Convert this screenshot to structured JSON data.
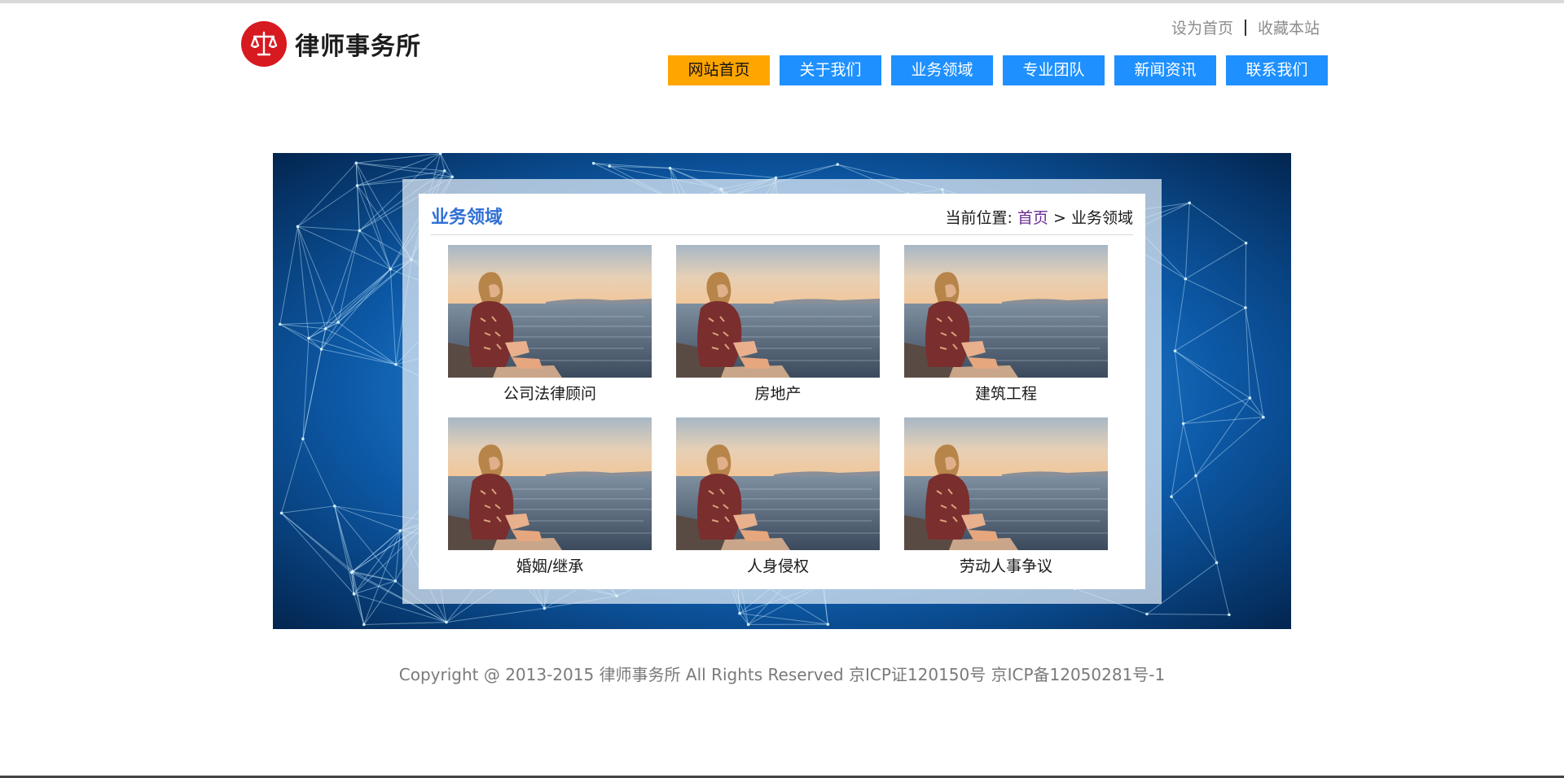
{
  "brand": {
    "name": "律师事务所",
    "color": "#d71920"
  },
  "quick_links": {
    "set_home": "设为首页",
    "bookmark": "收藏本站"
  },
  "nav": {
    "items": [
      {
        "label": "网站首页",
        "active": true
      },
      {
        "label": "关于我们",
        "active": false
      },
      {
        "label": "业务领域",
        "active": false
      },
      {
        "label": "专业团队",
        "active": false
      },
      {
        "label": "新闻资讯",
        "active": false
      },
      {
        "label": "联系我们",
        "active": false
      }
    ],
    "active_color": "#ffa500",
    "color": "#1e90ff"
  },
  "section": {
    "title": "业务领域",
    "breadcrumb": {
      "prefix": "当前位置:",
      "home": "首页",
      "separator": ">",
      "current": "业务领域"
    }
  },
  "practice_areas": [
    {
      "label": "公司法律顾问"
    },
    {
      "label": "房地产"
    },
    {
      "label": "建筑工程"
    },
    {
      "label": "婚姻/继承"
    },
    {
      "label": "人身侵权"
    },
    {
      "label": "劳动人事争议"
    }
  ],
  "footer": {
    "text": "Copyright @ 2013-2015 律师事务所 All Rights Reserved 京ICP证120150号 京ICP备12050281号-1"
  }
}
